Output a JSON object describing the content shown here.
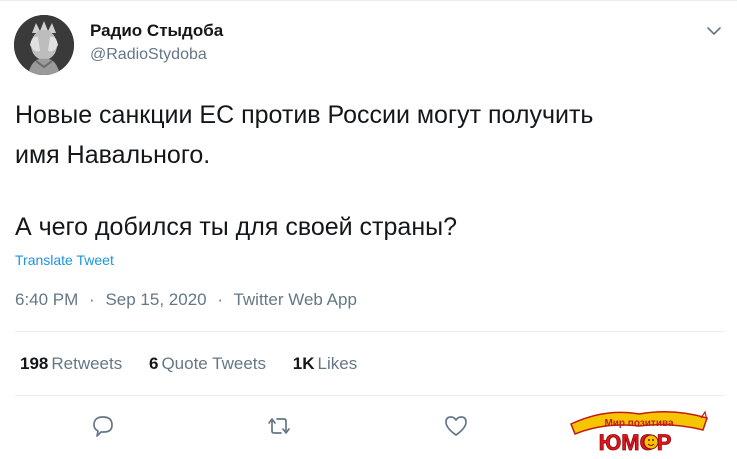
{
  "author": {
    "name": "Радио Стыдоба",
    "handle": "@RadioStydoba"
  },
  "tweet": {
    "line1": "Новые санкции ЕС против России могут получить",
    "line2": "имя Навального.",
    "line3": "А чего добился ты для своей страны?",
    "translate": "Translate Tweet"
  },
  "meta": {
    "time": "6:40 PM",
    "date": "Sep 15, 2020",
    "source": "Twitter Web App",
    "separator": "·"
  },
  "stats": [
    {
      "count": "198",
      "label": "Retweets"
    },
    {
      "count": "6",
      "label": "Quote Tweets"
    },
    {
      "count": "1K",
      "label": "Likes"
    }
  ],
  "icons": {
    "reply": "reply-icon",
    "retweet": "retweet-icon",
    "like": "heart-icon",
    "more": "chevron-down-icon"
  },
  "watermark": {
    "top": "Мир позитива",
    "bottom": "ЮМОР"
  },
  "colors": {
    "link": "#1b95e0",
    "muted": "#657786",
    "text": "#14171a"
  }
}
